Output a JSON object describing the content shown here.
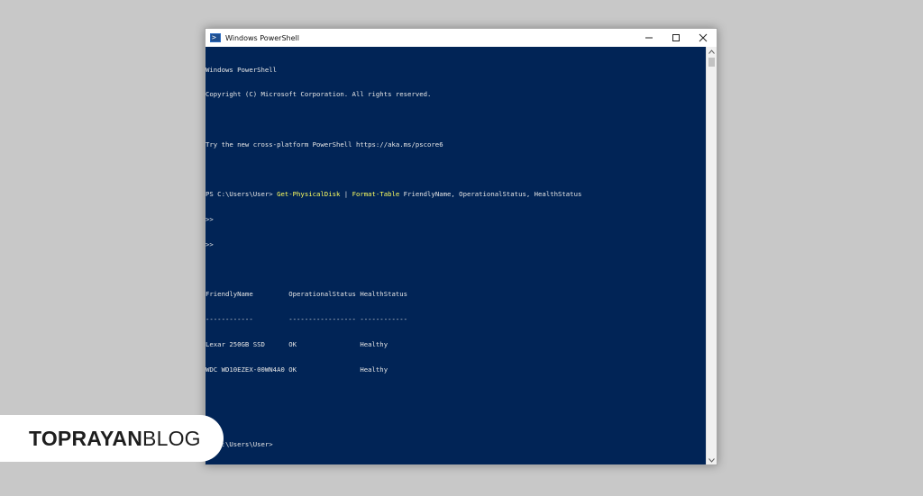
{
  "window": {
    "title": "Windows PowerShell",
    "icon": "powershell-icon",
    "controls": {
      "minimize": "minimize-icon",
      "maximize": "maximize-icon",
      "close": "close-icon"
    }
  },
  "console": {
    "line1": "Windows PowerShell",
    "line2": "Copyright (C) Microsoft Corporation. All rights reserved.",
    "line3": "Try the new cross-platform PowerShell https://aka.ms/pscore6",
    "prompt1": "PS C:\\Users\\User> ",
    "cmd_get": "Get-PhysicalDisk",
    "pipe": " | ",
    "cmd_format": "Format-Table",
    "cmd_args": " FriendlyName, OperationalStatus, HealthStatus",
    "cont1": ">>",
    "cont2": ">>",
    "table": {
      "header": "FriendlyName         OperationalStatus HealthStatus",
      "underline": "------------         ----------------- ------------",
      "rows": [
        "Lexar 250GB SSD      OK                Healthy",
        "WDC WD10EZEX-00WN4A0 OK                Healthy"
      ]
    },
    "prompt2": "PS C:\\Users\\User>"
  },
  "colors": {
    "console_bg": "#012456",
    "console_text": "#e6e6e6",
    "command_highlight": "#ffff5f"
  },
  "branding": {
    "bold": "TOPRAYAN",
    "light": "BLOG"
  }
}
